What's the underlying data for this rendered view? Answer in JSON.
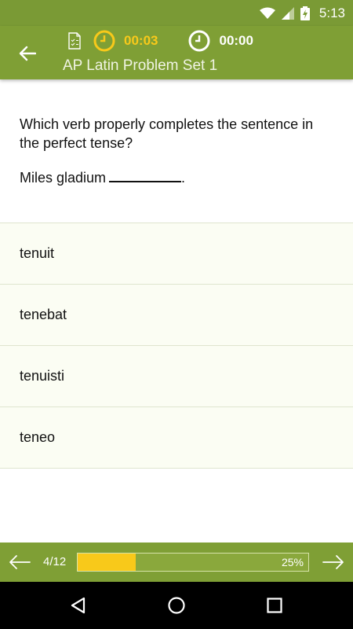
{
  "status_bar": {
    "time": "5:13"
  },
  "header": {
    "title": "AP Latin Problem Set 1",
    "timer_elapsed": "00:03",
    "timer_total": "00:00"
  },
  "question": {
    "prompt": "Which verb properly completes the sentence in the perfect tense?",
    "sentence": "Miles gladium",
    "sentence_end": "."
  },
  "answers": [
    {
      "label": "tenuit"
    },
    {
      "label": "tenebat"
    },
    {
      "label": "tenuisti"
    },
    {
      "label": "teneo"
    }
  ],
  "footer": {
    "position": "4/12",
    "progress_text": "25%",
    "progress_fraction": 0.25
  },
  "colors": {
    "accent": "#7f9f35",
    "highlight": "#f8c91a"
  },
  "icons": {
    "back": "arrow-left-icon",
    "worksheet": "worksheet-icon",
    "clock": "clock-icon",
    "prev": "arrow-left-icon",
    "next": "arrow-right-icon"
  }
}
